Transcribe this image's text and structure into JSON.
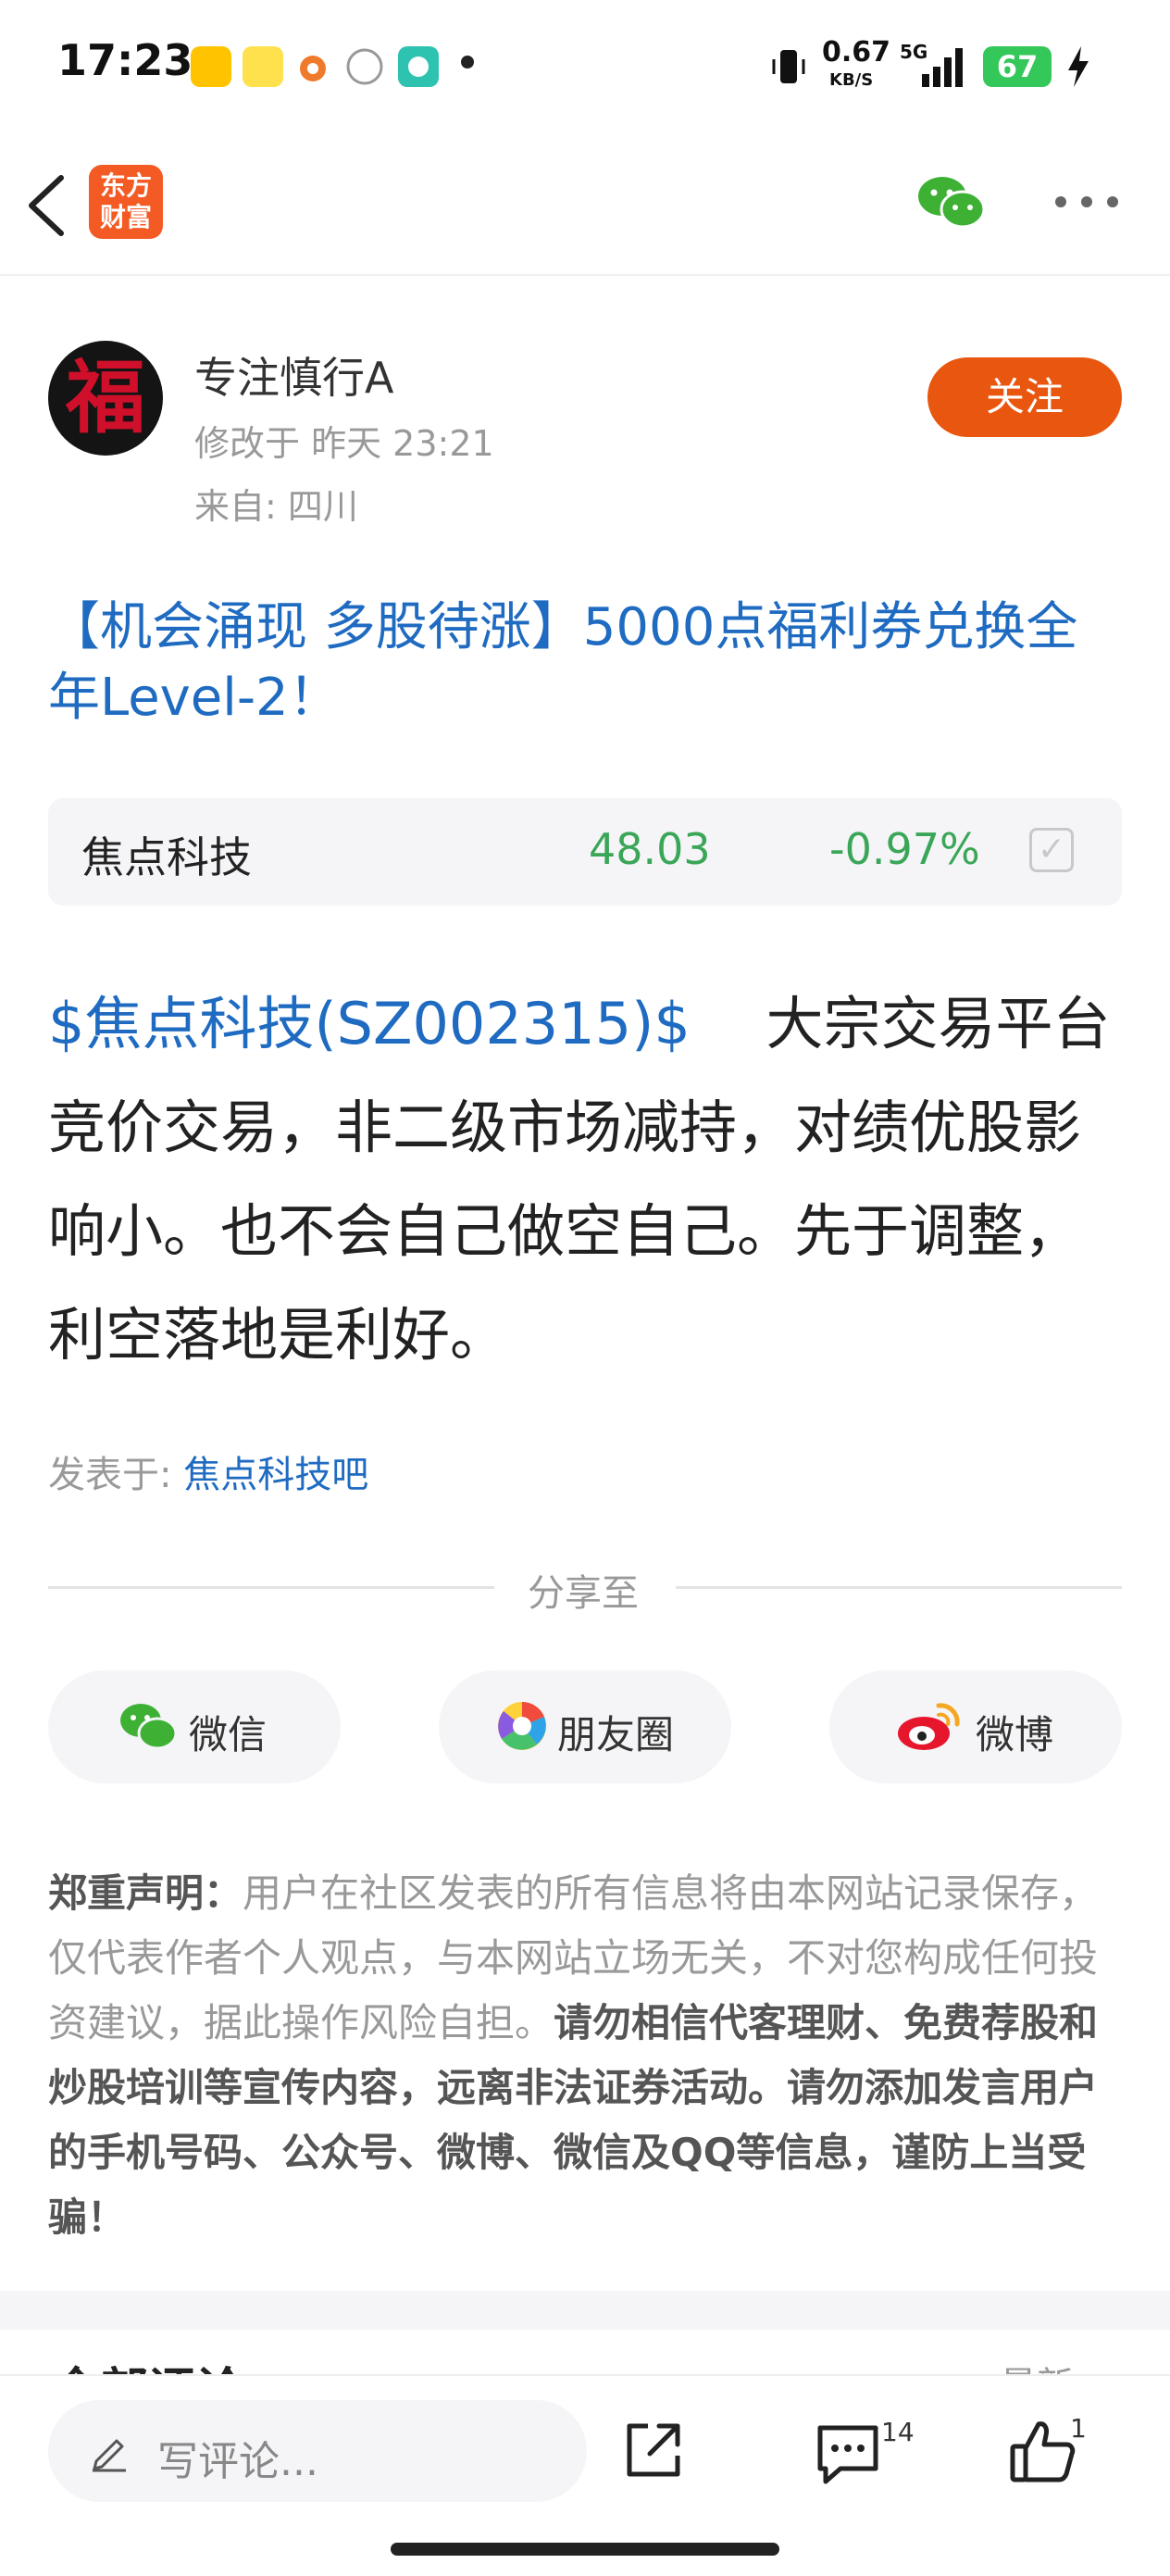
{
  "status_bar": {
    "time": "17:23",
    "net_speed": "0.67",
    "net_unit": "KB/S",
    "network": "5G",
    "battery": "67",
    "app_icons": [
      "meituan-icon",
      "jd-icon",
      "app-icon-3",
      "realme-icon",
      "chat-app-icon"
    ]
  },
  "nav": {
    "logo_text_line1": "东方",
    "logo_text_line2": "财富"
  },
  "author": {
    "avatar_glyph": "福",
    "name": "专注慎行A",
    "edited": "修改于 昨天 23:21",
    "location": "来自: 四川",
    "follow_label": "关注"
  },
  "post": {
    "title": "【机会涌现 多股待涨】5000点福利券兑换全年Level-2！",
    "stock_mention": "$焦点科技(SZ002315)$",
    "body_text": "　 大宗交易平台竞价交易，非二级市场减持，对绩优股影响小。也不会自己做空自己。先于调整，利空落地是利好。",
    "posted_in_label": "发表于: ",
    "posted_in_link": "焦点科技吧"
  },
  "stock_card": {
    "name": "焦点科技",
    "price": "48.03",
    "change": "-0.97%",
    "change_color": "#3aa657"
  },
  "share": {
    "label": "分享至",
    "wechat": "微信",
    "moments": "朋友圈",
    "weibo": "微博"
  },
  "disclaimer": {
    "heading": "郑重声明：",
    "text": "用户在社区发表的所有信息将由本网站记录保存，仅代表作者个人观点，与本网站立场无关，不对您构成任何投资建议，据此操作风险自担。",
    "warning": "请勿相信代客理财、免费荐股和炒股培训等宣传内容，远离非法证券活动。请勿添加发言用户的手机号码、公众号、微博、微信及QQ等信息，谨防上当受骗！"
  },
  "comments": {
    "title": "全部评论",
    "sort": "最新"
  },
  "bottom_bar": {
    "comment_placeholder": "写评论...",
    "comment_count": "14",
    "like_count": "1"
  },
  "colors": {
    "accent": "#e8560f",
    "link": "#1f6bc1",
    "down": "#3aa657"
  }
}
